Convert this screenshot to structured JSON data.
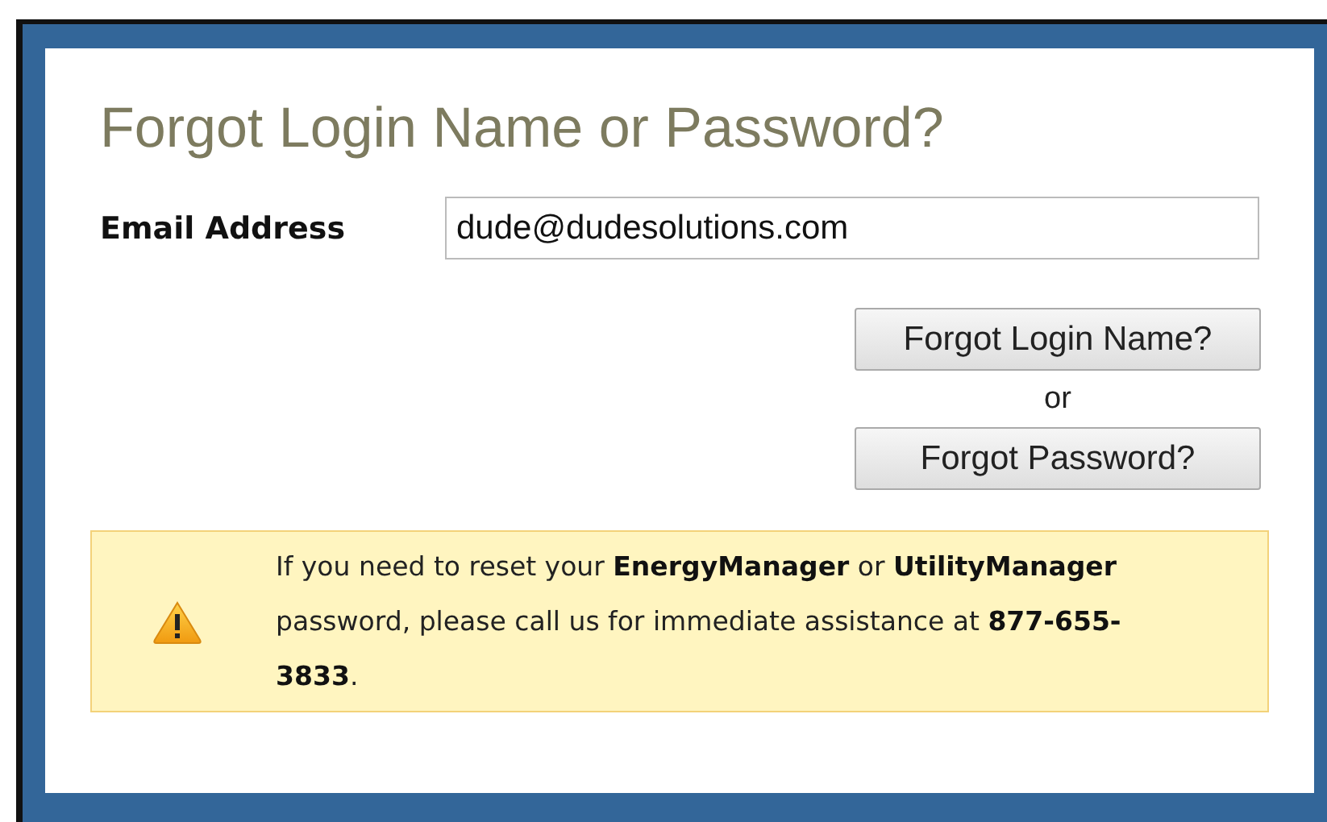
{
  "title": "Forgot Login Name or Password?",
  "email": {
    "label": "Email Address",
    "value": "dude@dudesolutions.com"
  },
  "buttons": [
    {
      "label": "Forgot Login Name?"
    },
    {
      "label": "Forgot Password?"
    }
  ],
  "separator": "or",
  "notice": {
    "text": "If you need to reset your **EnergyManager** or **UtilityManager** password, please call us for immediate assistance at **877-655-3833**."
  }
}
